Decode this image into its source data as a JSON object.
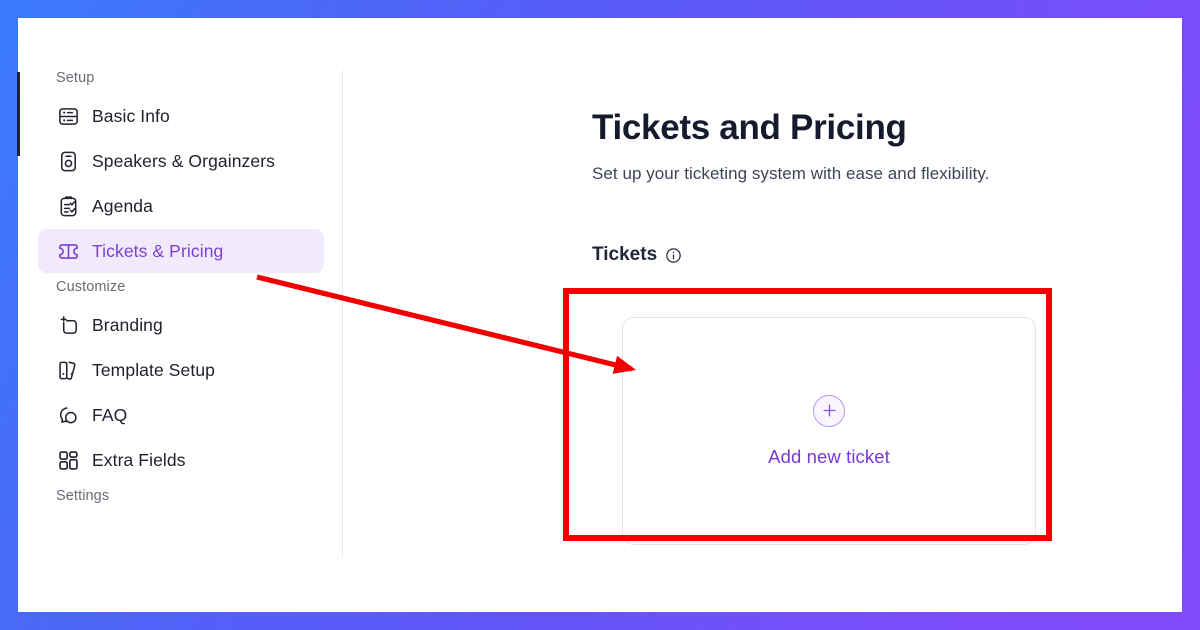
{
  "window": {
    "frame_gradient_start": "#3b7bfb",
    "frame_gradient_end": "#8249fc"
  },
  "sidebar": {
    "groups": [
      {
        "label": "Setup",
        "items": [
          {
            "label": "Basic Info",
            "icon": "basic-info-icon",
            "active": false
          },
          {
            "label": "Speakers & Orgainzers",
            "icon": "speakers-icon",
            "active": false
          },
          {
            "label": "Agenda",
            "icon": "agenda-clipboard-icon",
            "active": false
          },
          {
            "label": "Tickets & Pricing",
            "icon": "ticket-icon",
            "active": true
          }
        ]
      },
      {
        "label": "Customize",
        "items": [
          {
            "label": "Branding",
            "icon": "branding-icon",
            "active": false
          },
          {
            "label": "Template Setup",
            "icon": "template-setup-icon",
            "active": false
          },
          {
            "label": "FAQ",
            "icon": "faq-chat-icon",
            "active": false
          },
          {
            "label": "Extra Fields",
            "icon": "extra-fields-grid-icon",
            "active": false
          }
        ]
      },
      {
        "label": "Settings",
        "items": []
      }
    ],
    "active_item_bg": "#f1e9fc",
    "active_item_color": "#7b3fd4"
  },
  "main": {
    "title": "Tickets and Pricing",
    "subtitle": "Set up your ticketing system with ease and flexibility.",
    "section_heading": "Tickets",
    "section_info_icon": "info-circle-icon",
    "add_ticket": {
      "icon": "plus-circle-icon",
      "label": "Add new ticket",
      "accent_color": "#7638d6"
    }
  },
  "annotations": {
    "highlight_box_color": "#f20000",
    "arrow_color": "#f20000",
    "arrow_from": "Tickets & Pricing",
    "arrow_to": "Add new ticket card"
  }
}
